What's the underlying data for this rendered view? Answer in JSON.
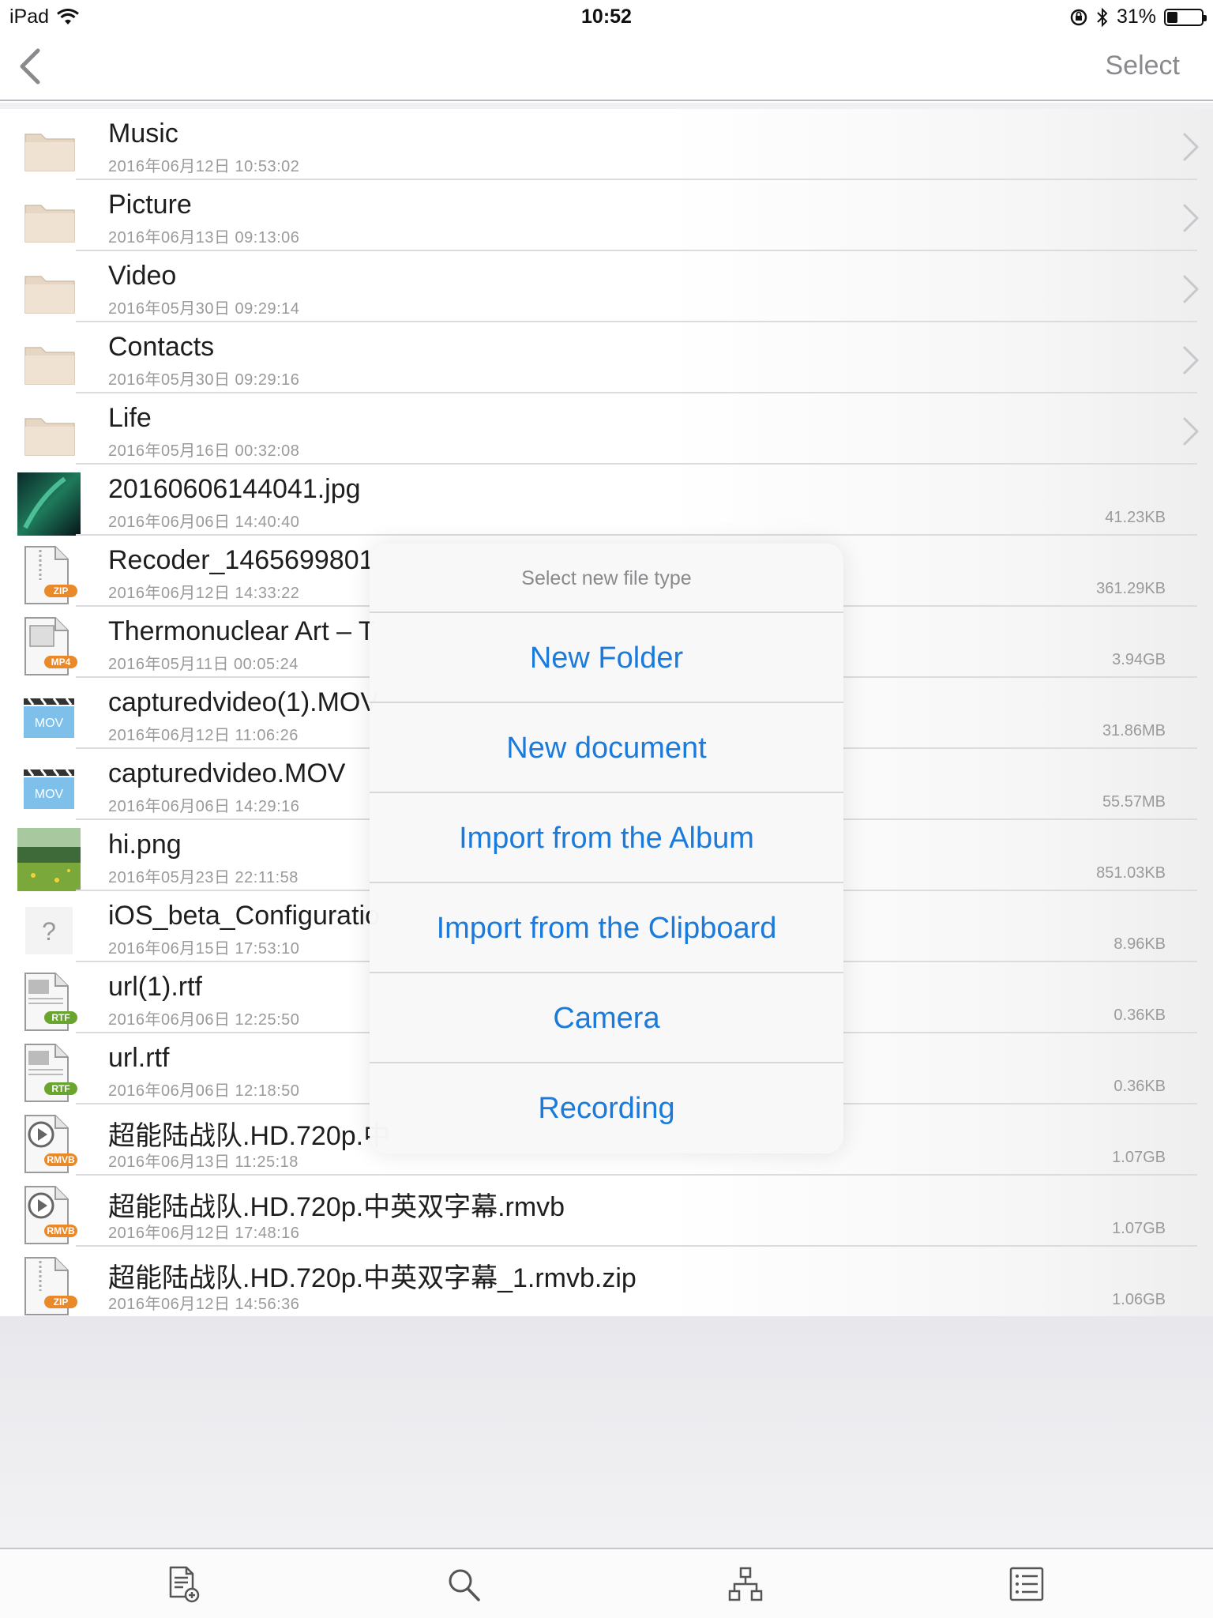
{
  "status_bar": {
    "device": "iPad",
    "time": "10:52",
    "battery_percent": "31%",
    "battery_level": 0.31
  },
  "nav": {
    "select_label": "Select"
  },
  "files": [
    {
      "name": "Music",
      "date": "2016年06月12日 10:53:02",
      "size": "",
      "icon": "folder-icon",
      "kind": "folder"
    },
    {
      "name": "Picture",
      "date": "2016年06月13日 09:13:06",
      "size": "",
      "icon": "folder-icon",
      "kind": "folder"
    },
    {
      "name": "Video",
      "date": "2016年05月30日 09:29:14",
      "size": "",
      "icon": "folder-icon",
      "kind": "folder"
    },
    {
      "name": "Contacts",
      "date": "2016年05月30日 09:29:16",
      "size": "",
      "icon": "folder-icon",
      "kind": "folder"
    },
    {
      "name": "Life",
      "date": "2016年05月16日 00:32:08",
      "size": "",
      "icon": "folder-icon",
      "kind": "folder"
    },
    {
      "name": "20160606144041.jpg",
      "date": "2016年06月06日 14:40:40",
      "size": "41.23KB",
      "icon": "aurora-thumbnail-icon",
      "kind": "image-aurora"
    },
    {
      "name": "Recoder_1465699801",
      "date": "2016年06月12日 14:33:22",
      "size": "361.29KB",
      "icon": "zip-file-icon",
      "kind": "zip",
      "badge": "ZIP"
    },
    {
      "name": "Thermonuclear Art – T",
      "date": "2016年05月11日 00:05:24",
      "size": "3.94GB",
      "icon": "mp4-file-icon",
      "kind": "mp4",
      "badge": "MP4"
    },
    {
      "name": "capturedvideo(1).MOV",
      "date": "2016年06月12日 11:06:26",
      "size": "31.86MB",
      "icon": "mov-file-icon",
      "kind": "mov",
      "badge": "MOV"
    },
    {
      "name": "capturedvideo.MOV",
      "date": "2016年06月06日 14:29:16",
      "size": "55.57MB",
      "icon": "mov-file-icon",
      "kind": "mov",
      "badge": "MOV"
    },
    {
      "name": "hi.png",
      "date": "2016年05月23日 22:11:58",
      "size": "851.03KB",
      "icon": "meadow-thumbnail-icon",
      "kind": "image-meadow"
    },
    {
      "name": "iOS_beta_Configuratio",
      "date": "2016年06月15日 17:53:10",
      "size": "8.96KB",
      "icon": "unknown-file-icon",
      "kind": "unknown",
      "badge": "?"
    },
    {
      "name": "url(1).rtf",
      "date": "2016年06月06日 12:25:50",
      "size": "0.36KB",
      "icon": "rtf-file-icon",
      "kind": "rtf",
      "badge": "RTF"
    },
    {
      "name": "url.rtf",
      "date": "2016年06月06日 12:18:50",
      "size": "0.36KB",
      "icon": "rtf-file-icon",
      "kind": "rtf",
      "badge": "RTF"
    },
    {
      "name": "超能陆战队.HD.720p.中",
      "date": "2016年06月13日 11:25:18",
      "size": "1.07GB",
      "icon": "rmvb-file-icon",
      "kind": "rmvb",
      "badge": "RMVB"
    },
    {
      "name": "超能陆战队.HD.720p.中英双字幕.rmvb",
      "date": "2016年06月12日 17:48:16",
      "size": "1.07GB",
      "icon": "rmvb-file-icon",
      "kind": "rmvb",
      "badge": "RMVB"
    },
    {
      "name": "超能陆战队.HD.720p.中英双字幕_1.rmvb.zip",
      "date": "2016年06月12日 14:56:36",
      "size": "1.06GB",
      "icon": "zip-file-icon",
      "kind": "zip",
      "badge": "ZIP"
    }
  ],
  "action_sheet": {
    "title": "Select new file type",
    "options": [
      "New Folder",
      "New document",
      "Import from the Album",
      "Import from the Clipboard",
      "Camera",
      "Recording"
    ]
  },
  "tab_bar": {
    "items": [
      "new-file-icon",
      "search-icon",
      "hierarchy-icon",
      "list-icon"
    ]
  },
  "colors": {
    "accent": "#1a7bdc",
    "folder": "#e6d6c4",
    "zip_badge": "#e9892a",
    "rtf_badge": "#6aa52f",
    "mov_badge": "#7fc0ea"
  }
}
